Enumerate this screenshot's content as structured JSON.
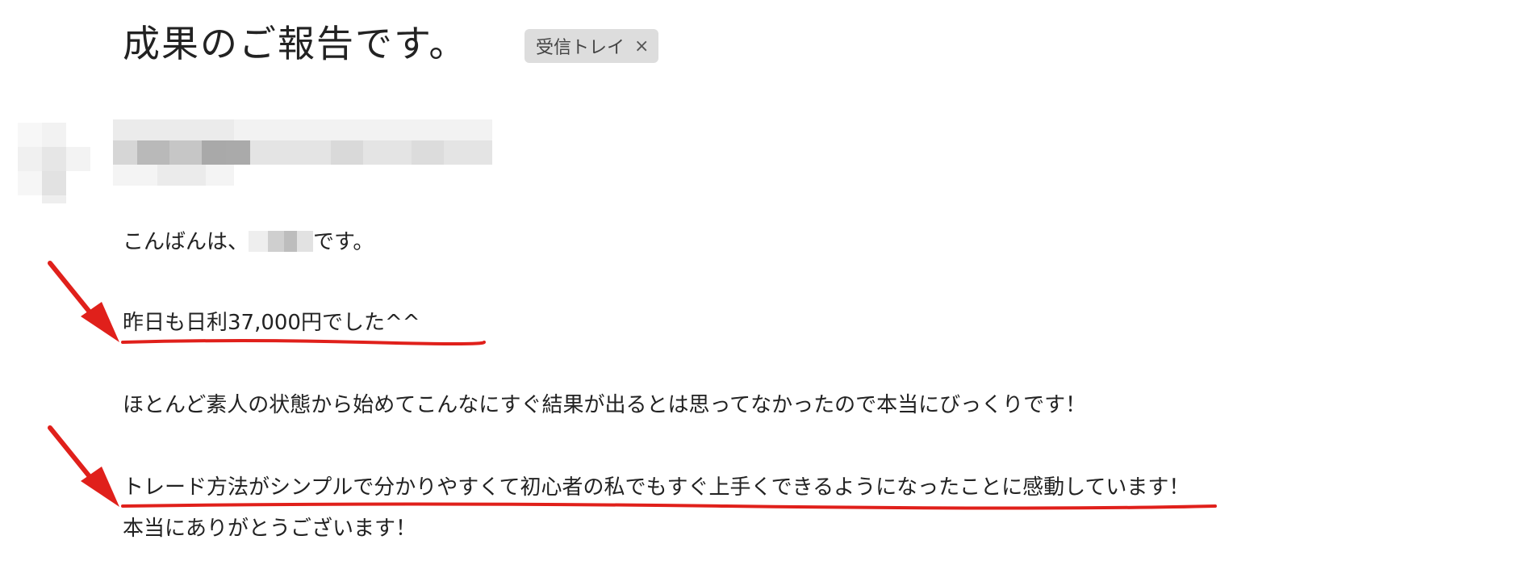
{
  "email": {
    "subject": "成果のご報告です。",
    "label_chip": {
      "text": "受信トレイ",
      "close_glyph": "×"
    },
    "body": {
      "greeting_before": "こんばんは、",
      "greeting_after": "です。",
      "line2": "昨日も日利37,000円でした^^",
      "line3": "ほとんど素人の状態から始めてこんなにすぐ結果が出るとは思ってなかったので本当にびっくりです！",
      "line4": "トレード方法がシンプルで分かりやすくて初心者の私でもすぐ上手くできるようになったことに感動しています！",
      "line5": "本当にありがとうございます！"
    }
  },
  "colors": {
    "annotation_red": "#e0201b",
    "chip_bg": "#dddddd",
    "text": "#222222"
  },
  "icons": [
    "close-icon",
    "arrow-annotation",
    "underline-annotation"
  ]
}
